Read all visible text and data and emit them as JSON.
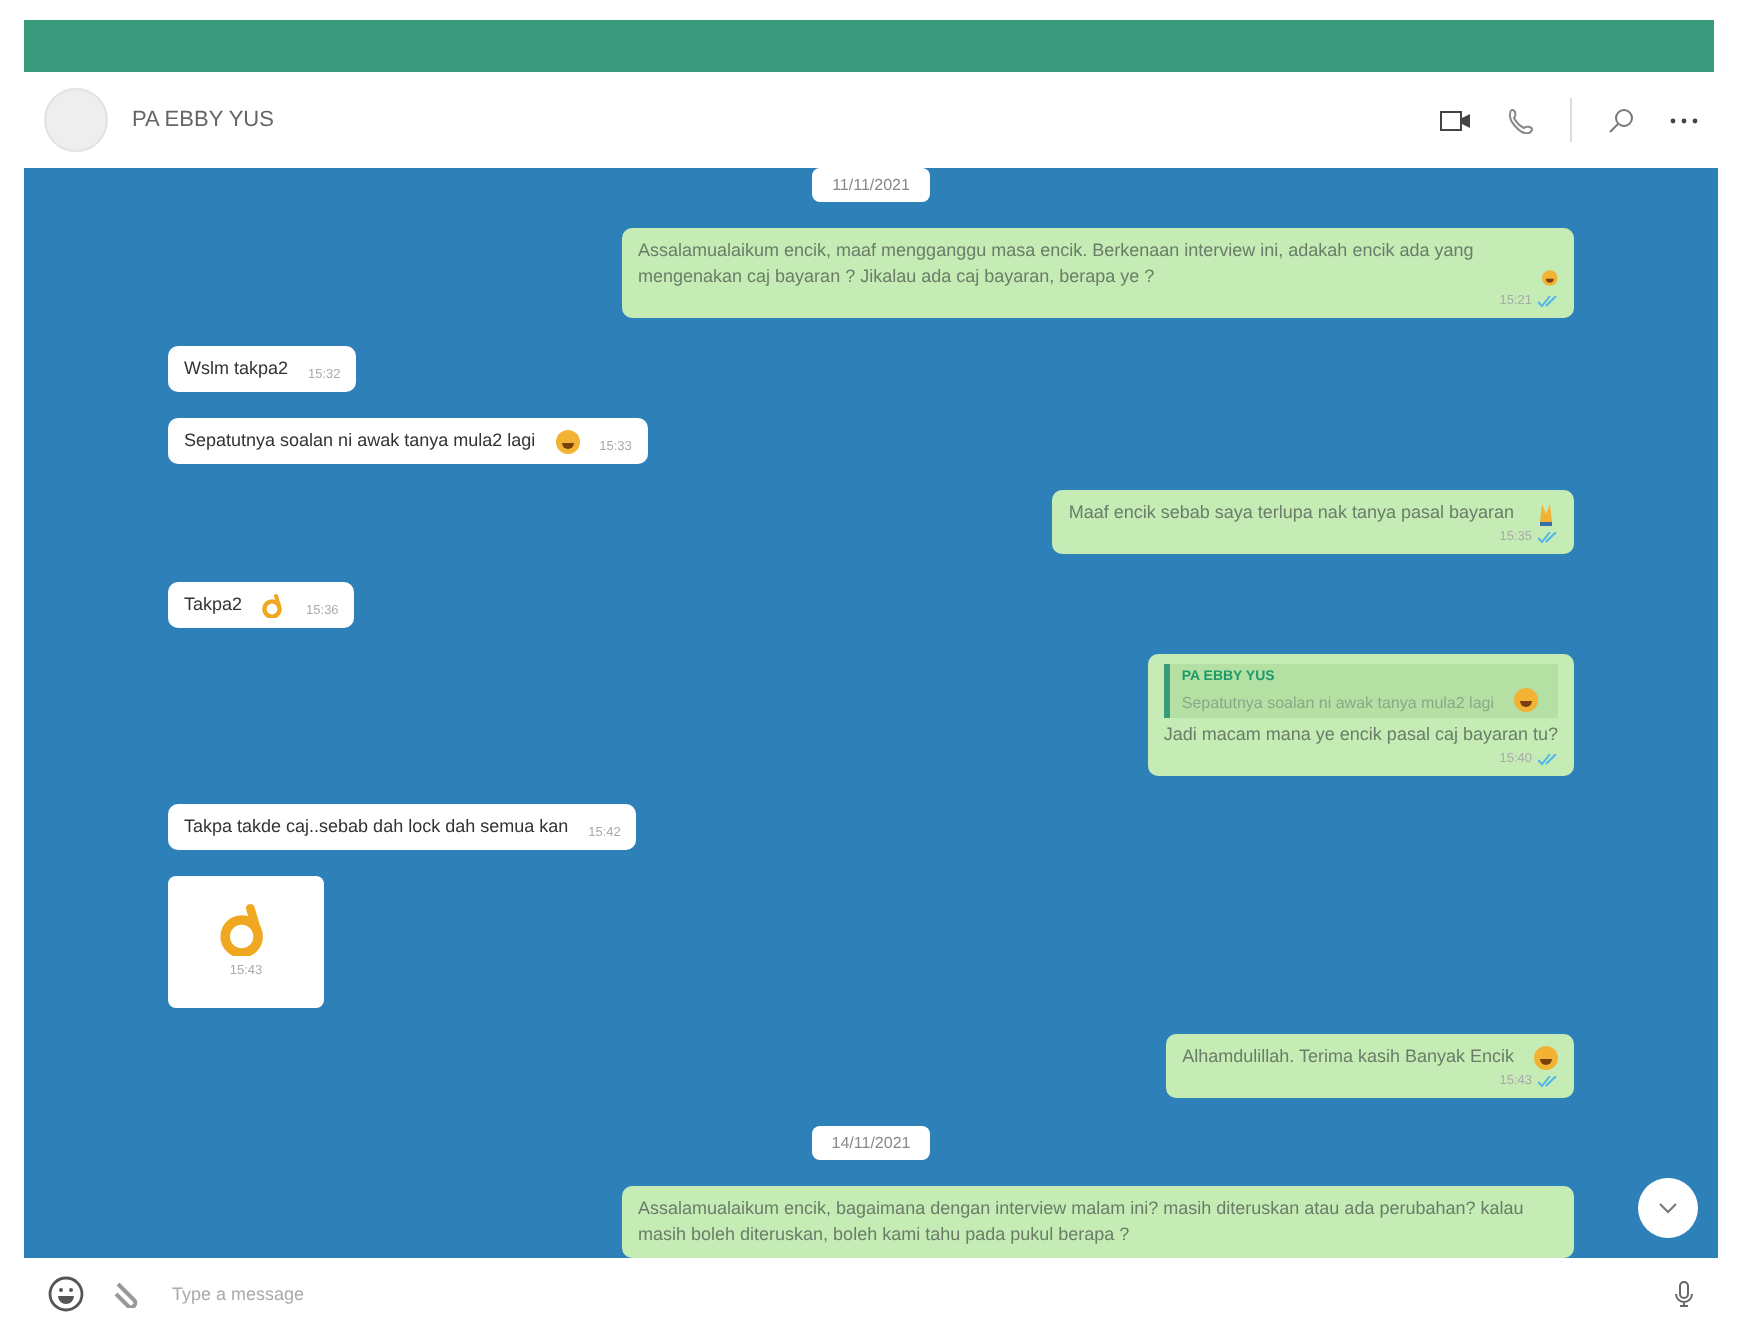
{
  "header": {
    "contact": "PA EBBY YUS"
  },
  "messages": [
    {
      "kind": "date",
      "text": "11/11/2021"
    },
    {
      "kind": "outgoing",
      "text": "Assalamualaikum encik, maaf mengganggu masa encik. Berkenaan interview ini, adakah encik ada yang mengenakan caj bayaran ? Jikalau ada caj bayaran, berapa ye ?",
      "emoji": {
        "kind": "grin"
      },
      "time": "15:21"
    },
    {
      "kind": "incoming",
      "text": "Wslm takpa2",
      "time": "15:32"
    },
    {
      "kind": "incoming",
      "text": "Sepatutnya soalan ni awak tanya mula2 lagi",
      "emoji": {
        "kind": "grin"
      },
      "time": "15:33"
    },
    {
      "kind": "outgoing",
      "text": "Maaf encik sebab saya terlupa nak tanya pasal bayaran",
      "emoji": {
        "kind": "pray"
      },
      "time": "15:35"
    },
    {
      "kind": "incoming",
      "text": "Takpa2",
      "emoji": {
        "kind": "ok"
      },
      "time": "15:36"
    },
    {
      "kind": "reply",
      "quote_author": "PA EBBY YUS",
      "quote": "Sepatutnya soalan ni awak tanya mula2 lagi",
      "quote_emoji": {
        "kind": "grin"
      },
      "text": "Jadi macam mana ye encik pasal caj bayaran tu?",
      "time": "15:40"
    },
    {
      "kind": "incoming",
      "text": "Takpa takde caj..sebab dah lock dah semua kan",
      "time": "15:42"
    },
    {
      "kind": "sticker",
      "emoji": {
        "kind": "ok"
      },
      "time": "15:43"
    },
    {
      "kind": "outgoing",
      "text": "Alhamdulillah. Terima kasih Banyak Encik",
      "emoji": {
        "kind": "grin"
      },
      "time": "15:43"
    },
    {
      "kind": "date",
      "text": "14/11/2021"
    },
    {
      "kind": "outgoing",
      "text": "Assalamualaikum encik, bagaimana dengan interview malam ini? masih diteruskan atau ada perubahan? kalau masih boleh diteruskan, boleh kami tahu pada pukul berapa ?"
    }
  ],
  "composer": {
    "placeholder": "Type a message"
  }
}
